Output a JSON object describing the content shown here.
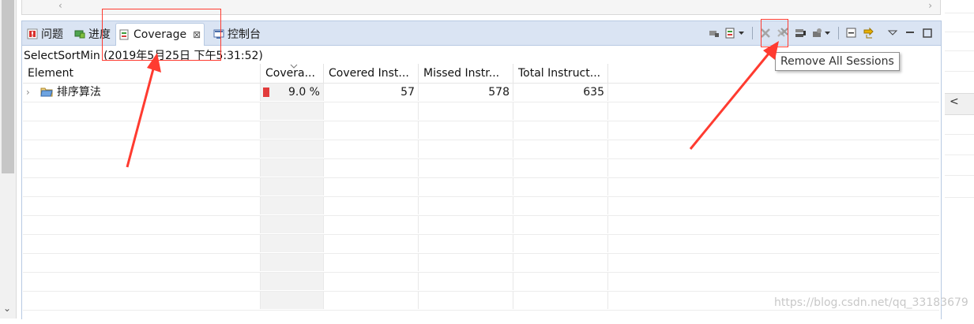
{
  "editor_strip": {
    "left_arrow": "‹",
    "right_arrow": "›"
  },
  "tabs": [
    {
      "label": "问题",
      "icon": "problems-icon"
    },
    {
      "label": "进度",
      "icon": "progress-icon"
    },
    {
      "label": "Coverage",
      "icon": "coverage-icon",
      "active": true,
      "close": "⊠"
    },
    {
      "label": "控制台",
      "icon": "console-icon"
    }
  ],
  "toolbar": {
    "icons": [
      "coverage-launch-icon",
      "session-dropdown-icon",
      "remove-session-icon",
      "remove-all-sessions-icon",
      "merge-sessions-icon",
      "import-icon",
      "collapse-all-icon",
      "link-with-selection-icon",
      "view-menu-icon",
      "minimize-icon",
      "maximize-icon"
    ]
  },
  "session_label": "SelectSortMin (2019年5月25日 下午5:31:52)",
  "table": {
    "columns": [
      "Element",
      "Covera...",
      "Covered Inst...",
      "Missed Instr...",
      "Total Instruct..."
    ],
    "rows": [
      {
        "element": "排序算法",
        "coverage": "9.0 %",
        "covered": "57",
        "missed": "578",
        "total": "635"
      }
    ],
    "empty_rows": 11
  },
  "tooltip": "Remove All Sessions",
  "right_side": {
    "scroll_arrow": "<"
  },
  "watermark": "https://blog.csdn.net/qq_33183679",
  "colors": {
    "annotation_red": "#ff3b30",
    "tabbar_bg": "#dae4f3",
    "coverage_bar": "#e23b3b"
  }
}
